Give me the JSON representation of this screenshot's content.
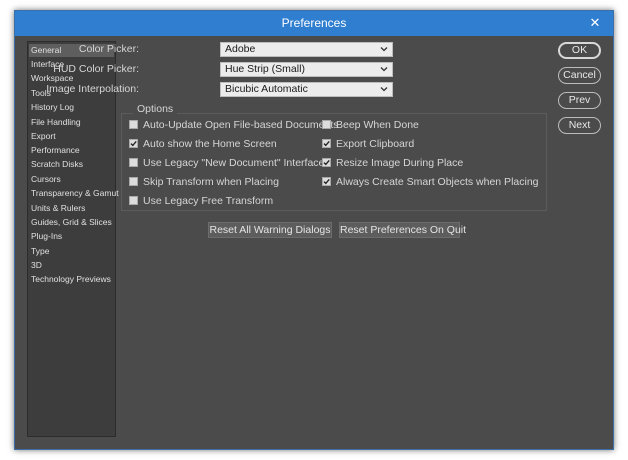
{
  "window": {
    "title": "Preferences",
    "close_glyph": "✕",
    "titlebar_color": "#2f7ed0"
  },
  "sidebar": {
    "items": [
      "General",
      "Interface",
      "Workspace",
      "Tools",
      "History Log",
      "File Handling",
      "Export",
      "Performance",
      "Scratch Disks",
      "Cursors",
      "Transparency & Gamut",
      "Units & Rulers",
      "Guides, Grid & Slices",
      "Plug-Ins",
      "Type",
      "3D",
      "Technology Previews"
    ],
    "selected": "General"
  },
  "fields": {
    "color_picker": {
      "label": "Color Picker:",
      "value": "Adobe"
    },
    "hud_color_picker": {
      "label": "HUD Color Picker:",
      "value": "Hue Strip (Small)"
    },
    "image_interpolation": {
      "label": "Image Interpolation:",
      "value": "Bicubic Automatic"
    }
  },
  "options": {
    "legend": "Options",
    "left": [
      {
        "label": "Auto-Update Open File-based Documents",
        "checked": false
      },
      {
        "label": "Auto show the Home Screen",
        "checked": true
      },
      {
        "label": "Use Legacy \"New Document\" Interface",
        "checked": false
      },
      {
        "label": "Skip Transform when Placing",
        "checked": false
      },
      {
        "label": "Use Legacy Free Transform",
        "checked": false
      }
    ],
    "right": [
      {
        "label": "Beep When Done",
        "checked": false
      },
      {
        "label": "Export Clipboard",
        "checked": true
      },
      {
        "label": "Resize Image During Place",
        "checked": true
      },
      {
        "label": "Always Create Smart Objects when Placing",
        "checked": true
      }
    ]
  },
  "buttons": {
    "ok": "OK",
    "cancel": "Cancel",
    "prev": "Prev",
    "next": "Next",
    "reset_warnings": "Reset All Warning Dialogs",
    "reset_on_quit": "Reset Preferences On Quit"
  }
}
